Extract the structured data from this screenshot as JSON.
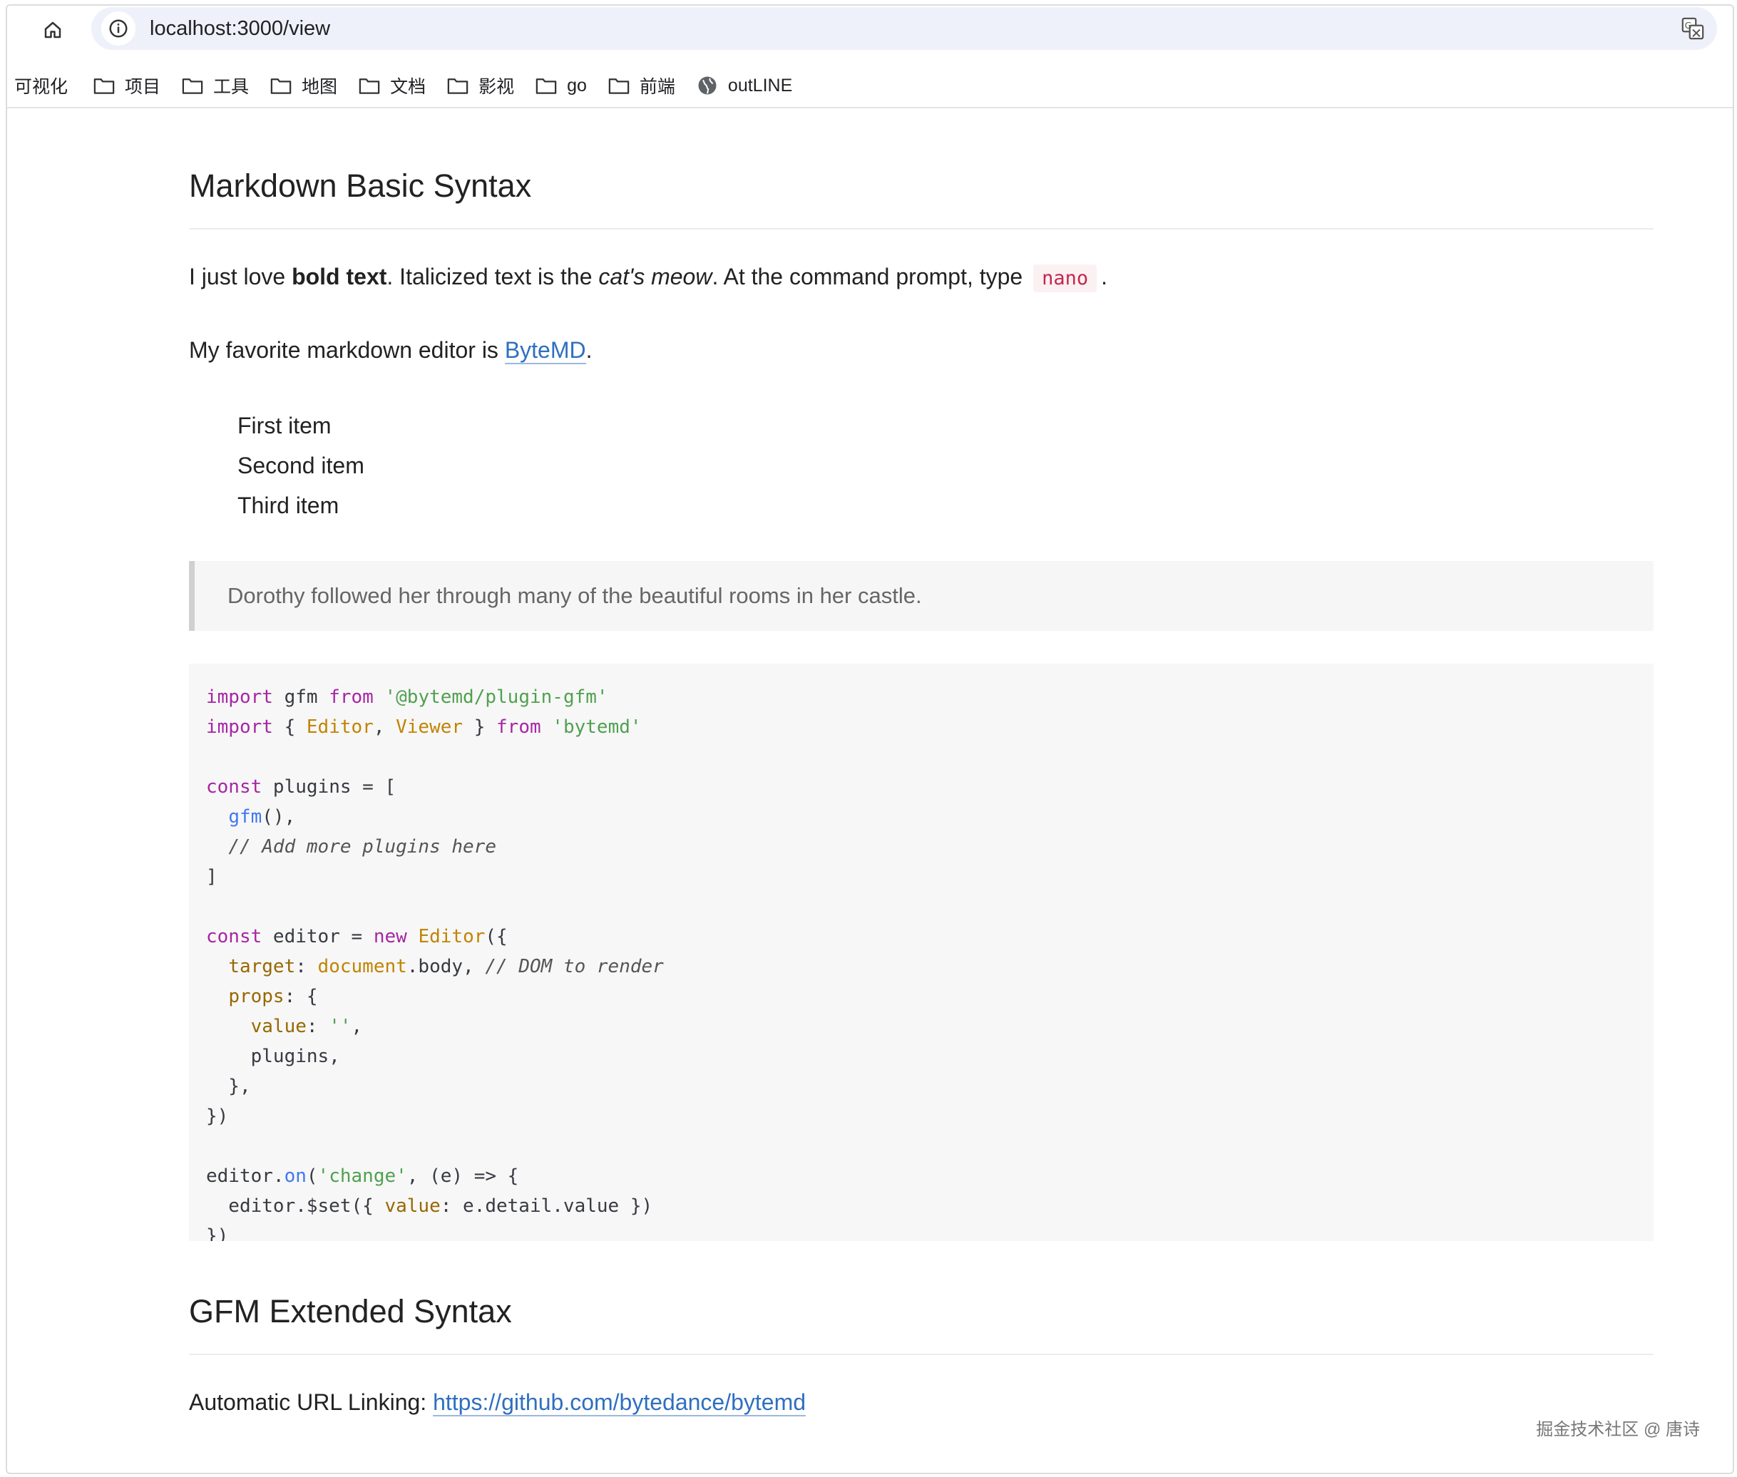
{
  "browser": {
    "url": "localhost:3000/view",
    "bookmarks": [
      {
        "label": "可视化",
        "icon": "none"
      },
      {
        "label": "项目",
        "icon": "folder-icon"
      },
      {
        "label": "工具",
        "icon": "folder-icon"
      },
      {
        "label": "地图",
        "icon": "folder-icon"
      },
      {
        "label": "文档",
        "icon": "folder-icon"
      },
      {
        "label": "影视",
        "icon": "folder-icon"
      },
      {
        "label": "go",
        "icon": "folder-icon"
      },
      {
        "label": "前端",
        "icon": "folder-icon"
      },
      {
        "label": "outLINE",
        "icon": "globe-icon"
      }
    ]
  },
  "doc": {
    "heading1": "Markdown Basic Syntax",
    "para1": {
      "t1": "I just love ",
      "bold": "bold text",
      "t2": ". Italicized text is the ",
      "italic": "cat's meow",
      "t3": ". At the command prompt, type ",
      "code": "nano",
      "t4": "."
    },
    "para2": {
      "t1": "My favorite markdown editor is ",
      "link": "ByteMD",
      "t2": "."
    },
    "list": [
      "First item",
      "Second item",
      "Third item"
    ],
    "quote": "Dorothy followed her through many of the beautiful rooms in her castle.",
    "code_lines": [
      [
        [
          "kw",
          "import"
        ],
        [
          "p",
          " gfm "
        ],
        [
          "kw",
          "from"
        ],
        [
          "p",
          " "
        ],
        [
          "str",
          "'@bytemd/plugin-gfm'"
        ]
      ],
      [
        [
          "kw",
          "import"
        ],
        [
          "p",
          " { "
        ],
        [
          "cls",
          "Editor"
        ],
        [
          "p",
          ", "
        ],
        [
          "cls",
          "Viewer"
        ],
        [
          "p",
          " } "
        ],
        [
          "kw",
          "from"
        ],
        [
          "p",
          " "
        ],
        [
          "str",
          "'bytemd'"
        ]
      ],
      [],
      [
        [
          "kw",
          "const"
        ],
        [
          "p",
          " plugins = ["
        ]
      ],
      [
        [
          "p",
          "  "
        ],
        [
          "fn",
          "gfm"
        ],
        [
          "p",
          "(),"
        ]
      ],
      [
        [
          "p",
          "  "
        ],
        [
          "cm",
          "// Add more plugins here"
        ]
      ],
      [
        [
          "p",
          "]"
        ]
      ],
      [],
      [
        [
          "kw",
          "const"
        ],
        [
          "p",
          " editor = "
        ],
        [
          "kw",
          "new"
        ],
        [
          "p",
          " "
        ],
        [
          "cls",
          "Editor"
        ],
        [
          "p",
          "({"
        ]
      ],
      [
        [
          "p",
          "  "
        ],
        [
          "attr",
          "target"
        ],
        [
          "p",
          ": "
        ],
        [
          "cls",
          "document"
        ],
        [
          "p",
          ".body, "
        ],
        [
          "cm",
          "// DOM to render"
        ]
      ],
      [
        [
          "p",
          "  "
        ],
        [
          "attr",
          "props"
        ],
        [
          "p",
          ": {"
        ]
      ],
      [
        [
          "p",
          "    "
        ],
        [
          "attr",
          "value"
        ],
        [
          "p",
          ": "
        ],
        [
          "str",
          "''"
        ],
        [
          "p",
          ","
        ]
      ],
      [
        [
          "p",
          "    plugins,"
        ]
      ],
      [
        [
          "p",
          "  },"
        ]
      ],
      [
        [
          "p",
          "})"
        ]
      ],
      [],
      [
        [
          "p",
          "editor."
        ],
        [
          "fn",
          "on"
        ],
        [
          "p",
          "("
        ],
        [
          "str",
          "'change'"
        ],
        [
          "p",
          ", (e) => {"
        ]
      ],
      [
        [
          "p",
          "  editor.$set({ "
        ],
        [
          "attr",
          "value"
        ],
        [
          "p",
          ": e.detail.value })"
        ]
      ],
      [
        [
          "p",
          "})"
        ]
      ]
    ],
    "heading2": "GFM Extended Syntax",
    "para3": {
      "t1": "Automatic URL Linking: ",
      "link": "https://github.com/bytedance/bytemd"
    }
  },
  "watermark": "掘金技术社区 @ 唐诗"
}
